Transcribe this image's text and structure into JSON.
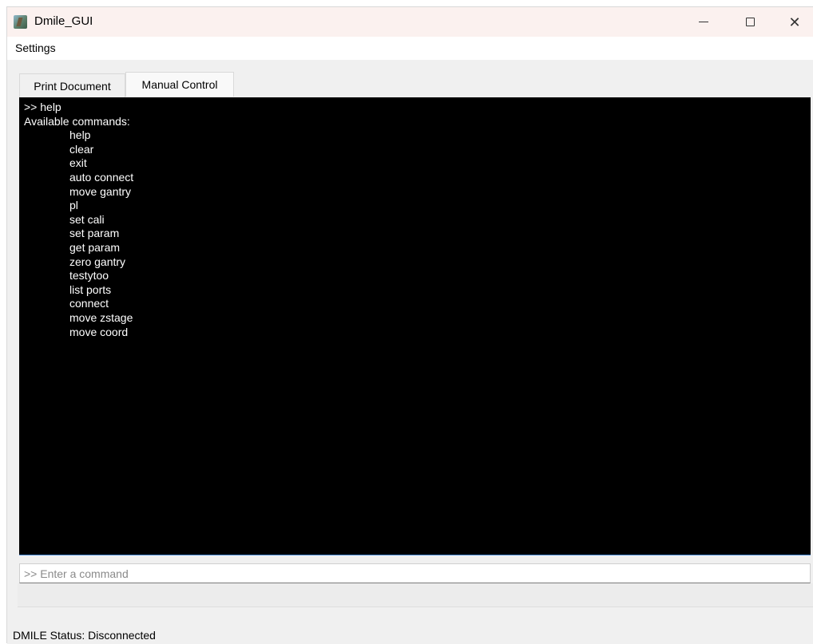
{
  "window": {
    "title": "Dmile_GUI",
    "icon": "app-icon",
    "controls": {
      "minimize": "minimize-icon",
      "maximize": "maximize-icon",
      "close": "close-icon"
    }
  },
  "menubar": {
    "items": [
      {
        "label": "Settings"
      }
    ]
  },
  "tabs": [
    {
      "label": "Print Document",
      "selected": false
    },
    {
      "label": "Manual Control",
      "selected": true
    }
  ],
  "console": {
    "prompt_line": ">> help",
    "header": "Available commands:",
    "commands": [
      "help",
      "clear",
      "exit",
      "auto connect",
      "move gantry",
      "pl",
      "set cali",
      "set param",
      "get param",
      "zero gantry",
      "testytoo",
      "list ports",
      "connect",
      "move zstage",
      "move coord"
    ]
  },
  "command_input": {
    "value": "",
    "placeholder": ">> Enter a command"
  },
  "status": {
    "text": "DMILE Status: Disconnected"
  }
}
